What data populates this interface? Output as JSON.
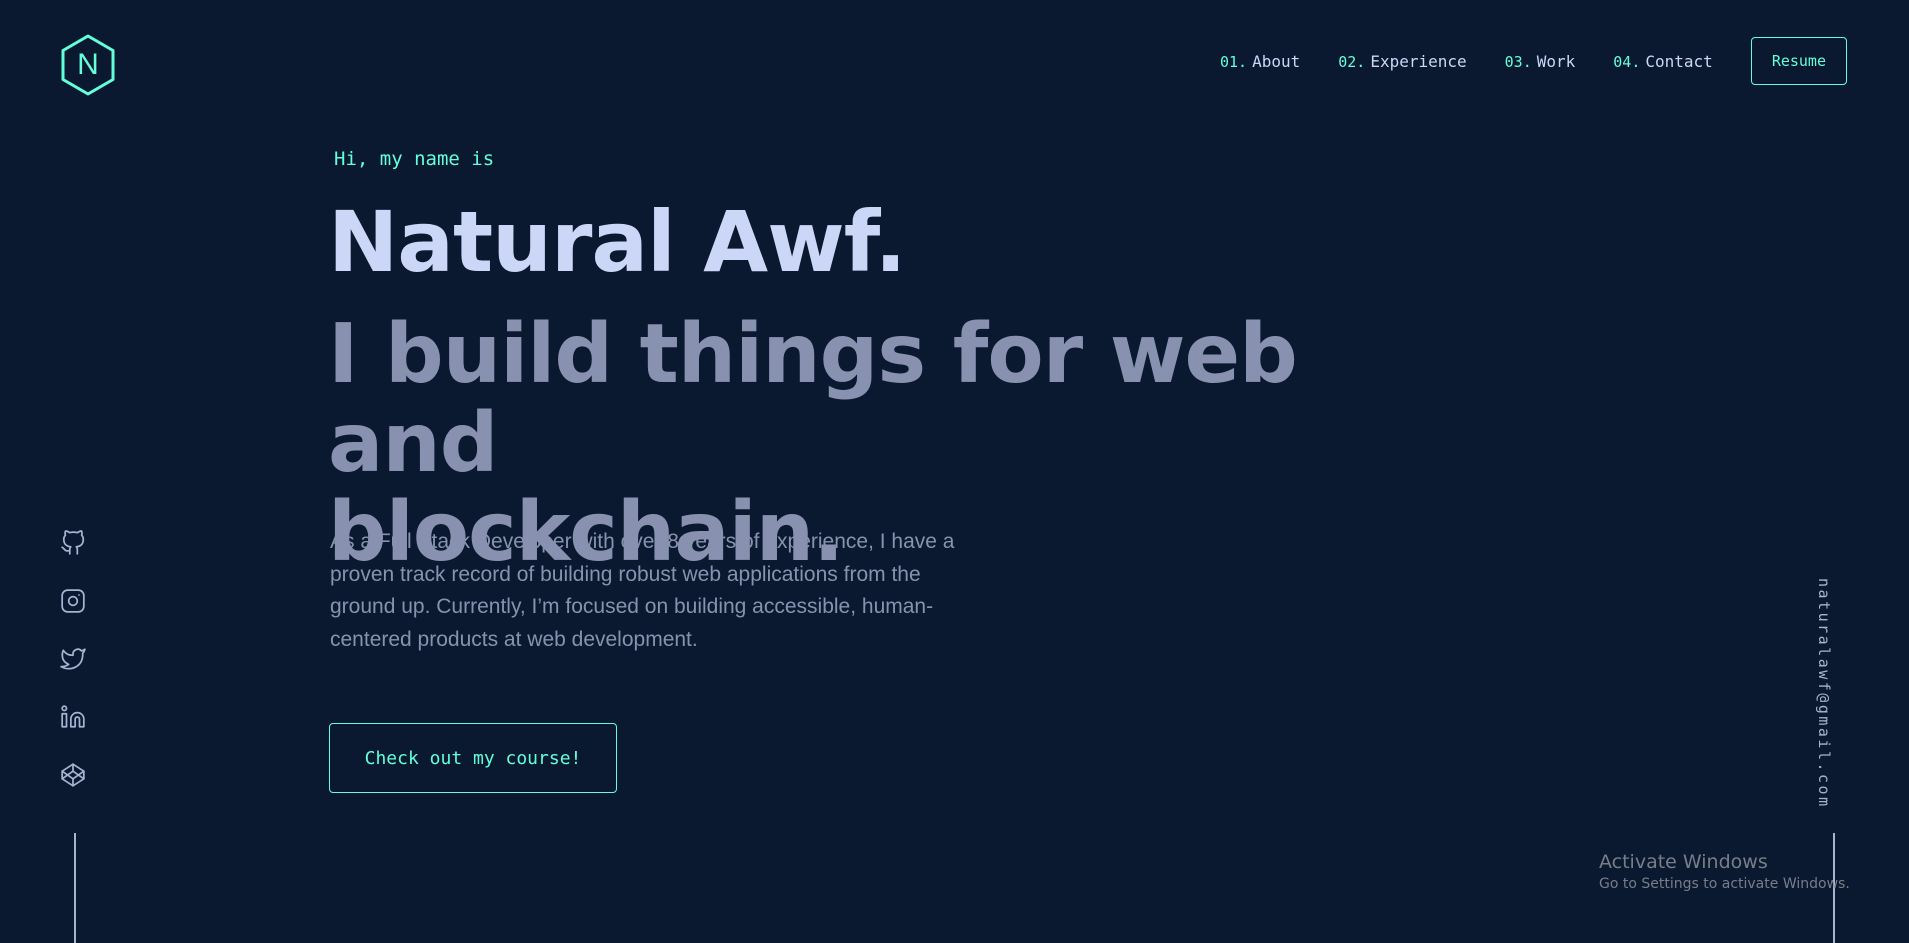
{
  "logo": {
    "letter": "N",
    "icon": "hexagon-logo-icon"
  },
  "nav": {
    "items": [
      {
        "num": "01.",
        "label": "About"
      },
      {
        "num": "02.",
        "label": "Experience"
      },
      {
        "num": "03.",
        "label": "Work"
      },
      {
        "num": "04.",
        "label": "Contact"
      }
    ],
    "resume_label": "Resume"
  },
  "hero": {
    "intro": "Hi, my name is",
    "name": "Natural Awf.",
    "tagline_line1": "I build things for web and",
    "tagline_line2": "blockchain.",
    "description": "As a Full Stack Developer with over 8 years of experience, I have a proven track record of building robust web applications from the ground up. Currently, I’m focused on building accessible, human-centered products at web development.",
    "cta_label": "Check out my course!"
  },
  "social": {
    "icons": [
      "github-icon",
      "instagram-icon",
      "twitter-icon",
      "linkedin-icon",
      "codepen-icon"
    ]
  },
  "email": "naturalawf@gmail.com",
  "watermark": {
    "title": "Activate Windows",
    "subtitle": "Go to Settings to activate Windows."
  },
  "colors": {
    "background": "#0a192f",
    "accent": "#64ffda",
    "heading": "#ccd6f6",
    "body": "#8892b0"
  }
}
